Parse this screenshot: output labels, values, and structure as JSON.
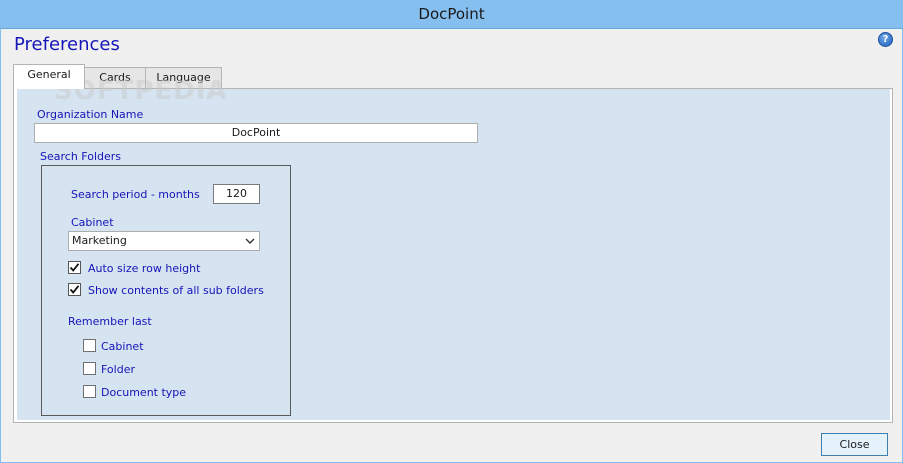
{
  "window": {
    "title": "DocPoint"
  },
  "header": {
    "heading": "Preferences",
    "help_icon": "help-icon",
    "help_glyph": "?"
  },
  "tabs": [
    {
      "label": "General",
      "active": true
    },
    {
      "label": "Cards",
      "active": false
    },
    {
      "label": "Language",
      "active": false
    }
  ],
  "watermark": "SOFTPEDIA",
  "general": {
    "organization_label": "Organization Name",
    "organization_value": "DocPoint",
    "search_folders_label": "Search Folders",
    "search_period_label": "Search period - months",
    "search_period_value": "120",
    "cabinet_label": "Cabinet",
    "cabinet_selected": "Marketing",
    "auto_size_label": "Auto size row height",
    "auto_size_checked": true,
    "show_contents_label": "Show contents of all sub folders",
    "show_contents_checked": true,
    "remember_last_label": "Remember last",
    "remember": [
      {
        "label": "Cabinet",
        "checked": false
      },
      {
        "label": "Folder",
        "checked": false
      },
      {
        "label": "Document type",
        "checked": false
      }
    ]
  },
  "footer": {
    "close_label": "Close"
  },
  "colors": {
    "titlebar": "#85bff0",
    "label_text": "#1515b8",
    "panel_background": "#d6e3f1"
  }
}
